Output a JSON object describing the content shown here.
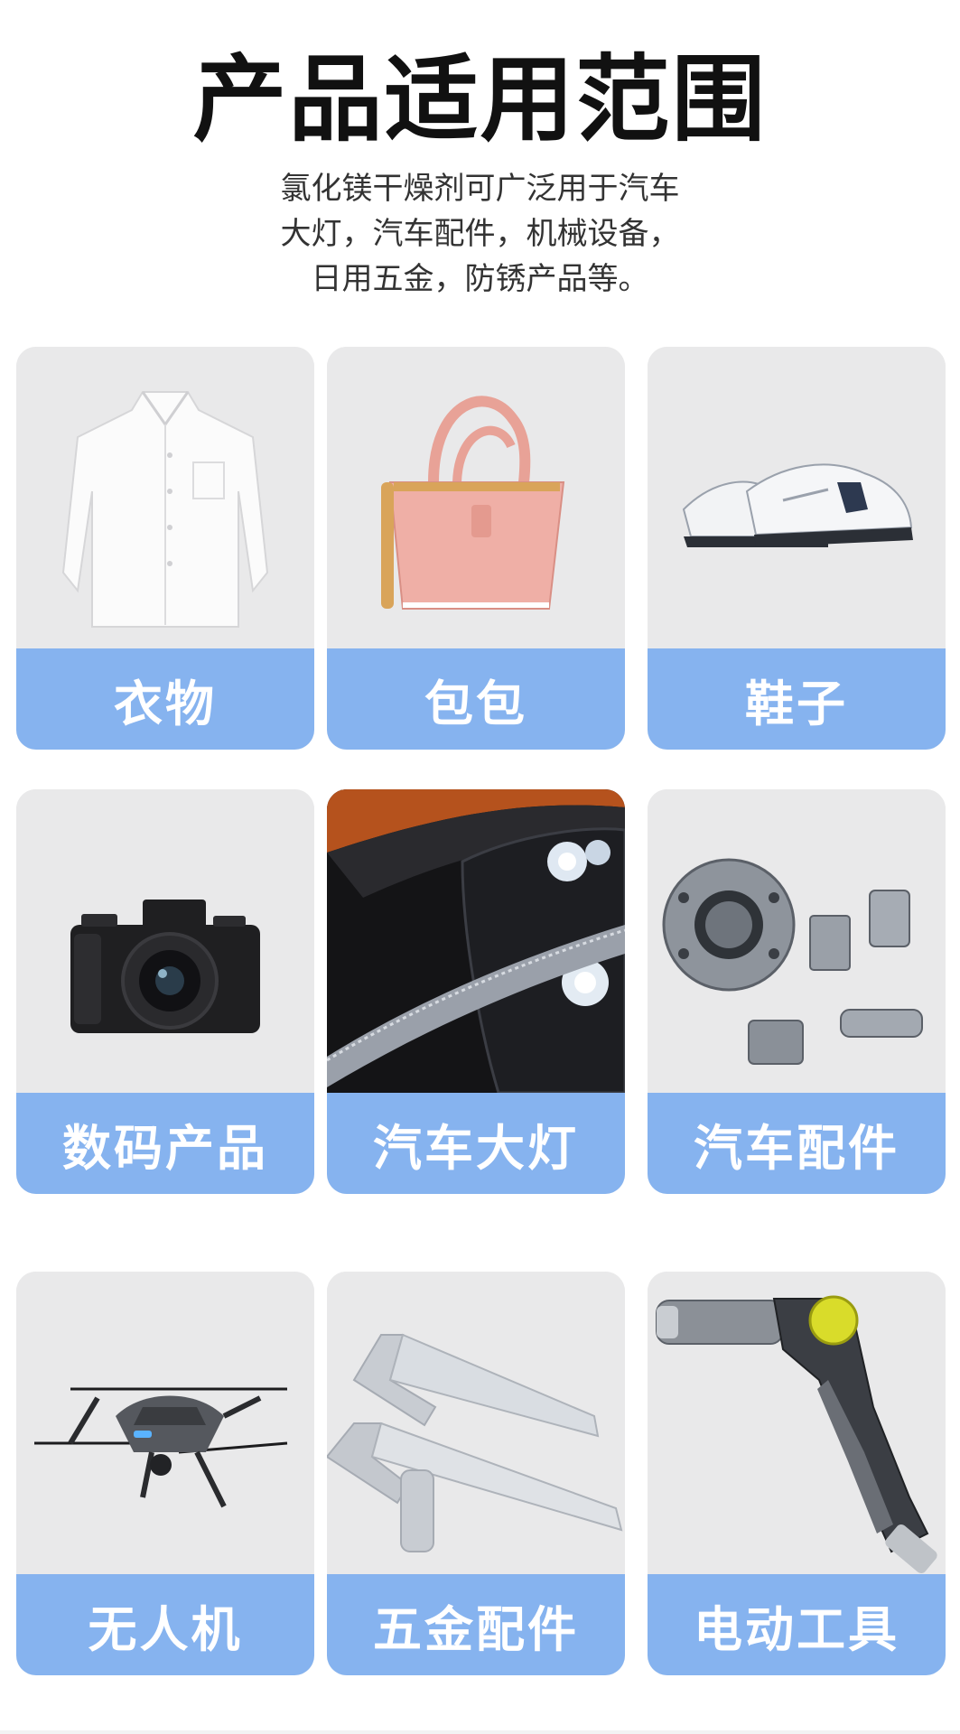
{
  "header": {
    "title": "产品适用范围",
    "subtitle_lines": [
      "氯化镁干燥剂可广泛用于汽车",
      "大灯，汽车配件，机械设备，",
      "日用五金，防锈产品等。"
    ]
  },
  "categories": [
    {
      "label": "衣物",
      "icon": "shirt-image"
    },
    {
      "label": "包包",
      "icon": "handbag-image"
    },
    {
      "label": "鞋子",
      "icon": "sneakers-image"
    },
    {
      "label": "数码产品",
      "icon": "camera-image"
    },
    {
      "label": "汽车大灯",
      "icon": "car-headlight-image"
    },
    {
      "label": "汽车配件",
      "icon": "metal-fittings-image"
    },
    {
      "label": "无人机",
      "icon": "drone-image"
    },
    {
      "label": "五金配件",
      "icon": "door-handle-image"
    },
    {
      "label": "电动工具",
      "icon": "spray-gun-image"
    }
  ],
  "colors": {
    "label_bar": "#86b3ef",
    "card_bg": "#e6e6e7",
    "title_text": "#111111"
  }
}
